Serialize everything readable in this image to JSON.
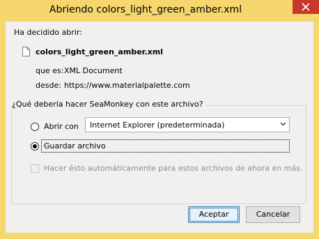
{
  "window": {
    "title": "Abriendo colors_light_green_amber.xml"
  },
  "dialog": {
    "intro": "Ha decidido abrir:",
    "file_name": "colors_light_green_amber.xml",
    "type_label": "que es:",
    "type_value": "XML Document",
    "from_label": "desde:",
    "from_value": "https://www.materialpalette.com",
    "question": "¿Qué debería hacer SeaMonkey con este archivo?",
    "open_with_label": "Abrir con",
    "open_with_app": "Internet Explorer (predeterminada)",
    "save_label": "Guardar archivo",
    "selected_option": "save",
    "auto_label": "Hacer ésto automáticamente para estos archivos de ahora en más.",
    "auto_checked": false,
    "auto_enabled": false
  },
  "buttons": {
    "accept": "Aceptar",
    "cancel": "Cancelar"
  },
  "colors": {
    "frame": "#f5d76e",
    "close": "#c7392b",
    "panel": "#f0f0f0"
  },
  "icons": {
    "file": "file-icon",
    "close": "close-icon",
    "dropdown": "chevron-down-icon"
  }
}
